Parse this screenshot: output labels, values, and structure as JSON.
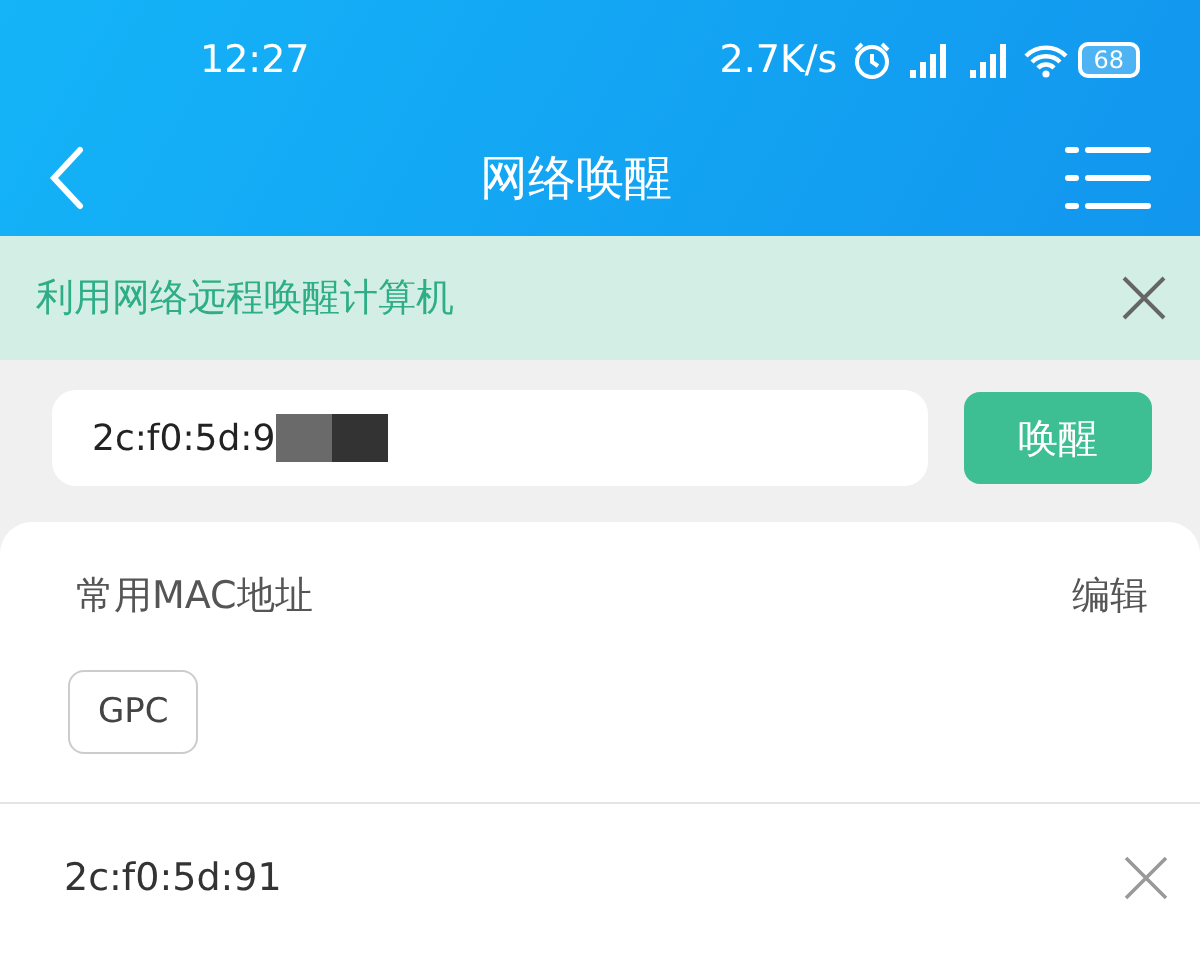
{
  "status_bar": {
    "time": "12:27",
    "speed": "2.7K/s",
    "battery": "68"
  },
  "nav": {
    "title": "网络唤醒"
  },
  "banner": {
    "text": "利用网络远程唤醒计算机"
  },
  "mac_input": {
    "value": "2c:f0:5d:9"
  },
  "wake_button": "唤醒",
  "favorites": {
    "title": "常用MAC地址",
    "edit": "编辑",
    "items": [
      "GPC"
    ]
  },
  "history": [
    {
      "mac": "2c:f0:5d:91"
    }
  ]
}
